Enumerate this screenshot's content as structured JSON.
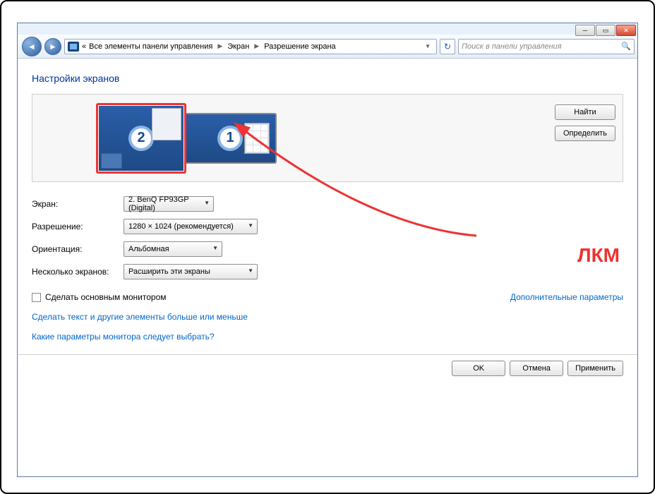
{
  "window_controls": {
    "minimize": "_",
    "maximize": "▭",
    "close": "✕"
  },
  "breadcrumb": {
    "prefix": "«",
    "items": [
      "Все элементы панели управления",
      "Экран",
      "Разрешение экрана"
    ]
  },
  "search": {
    "placeholder": "Поиск в панели управления"
  },
  "page_title": "Настройки экранов",
  "monitors": {
    "m1_label": "1",
    "m2_label": "2"
  },
  "monitor_buttons": {
    "find": "Найти",
    "identify": "Определить"
  },
  "form": {
    "display_label": "Экран:",
    "display_value": "2. BenQ FP93GP (Digital)",
    "resolution_label": "Разрешение:",
    "resolution_value": "1280 × 1024 (рекомендуется)",
    "orientation_label": "Ориентация:",
    "orientation_value": "Альбомная",
    "multi_label": "Несколько экранов:",
    "multi_value": "Расширить эти экраны"
  },
  "checkbox_label": "Сделать основным монитором",
  "advanced_link": "Дополнительные параметры",
  "link_text_size": "Сделать текст и другие элементы больше или меньше",
  "link_help": "Какие параметры монитора следует выбрать?",
  "footer": {
    "ok": "OK",
    "cancel": "Отмена",
    "apply": "Применить"
  },
  "annotation": "ЛКМ"
}
